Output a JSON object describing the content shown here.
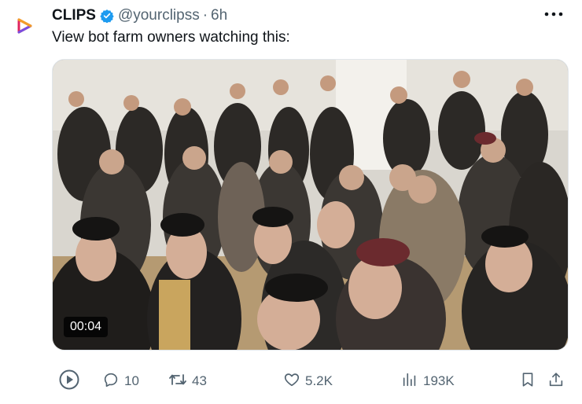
{
  "author": {
    "name": "CLIPS",
    "handle": "@yourclipss",
    "separator": "·",
    "time": "6h",
    "verified": true,
    "avatar_icon": "clips-logo-icon"
  },
  "post": {
    "text": "View bot farm owners watching this:"
  },
  "media": {
    "type": "video",
    "duration": "00:04"
  },
  "actions": {
    "play_icon": "play-circle-icon",
    "replies": "10",
    "reposts": "43",
    "likes": "5.2K",
    "views": "193K",
    "bookmark_icon": "bookmark-icon",
    "share_icon": "share-icon"
  },
  "colors": {
    "text": "#0f1419",
    "secondary": "#536471",
    "verified": "#1d9bf0"
  }
}
